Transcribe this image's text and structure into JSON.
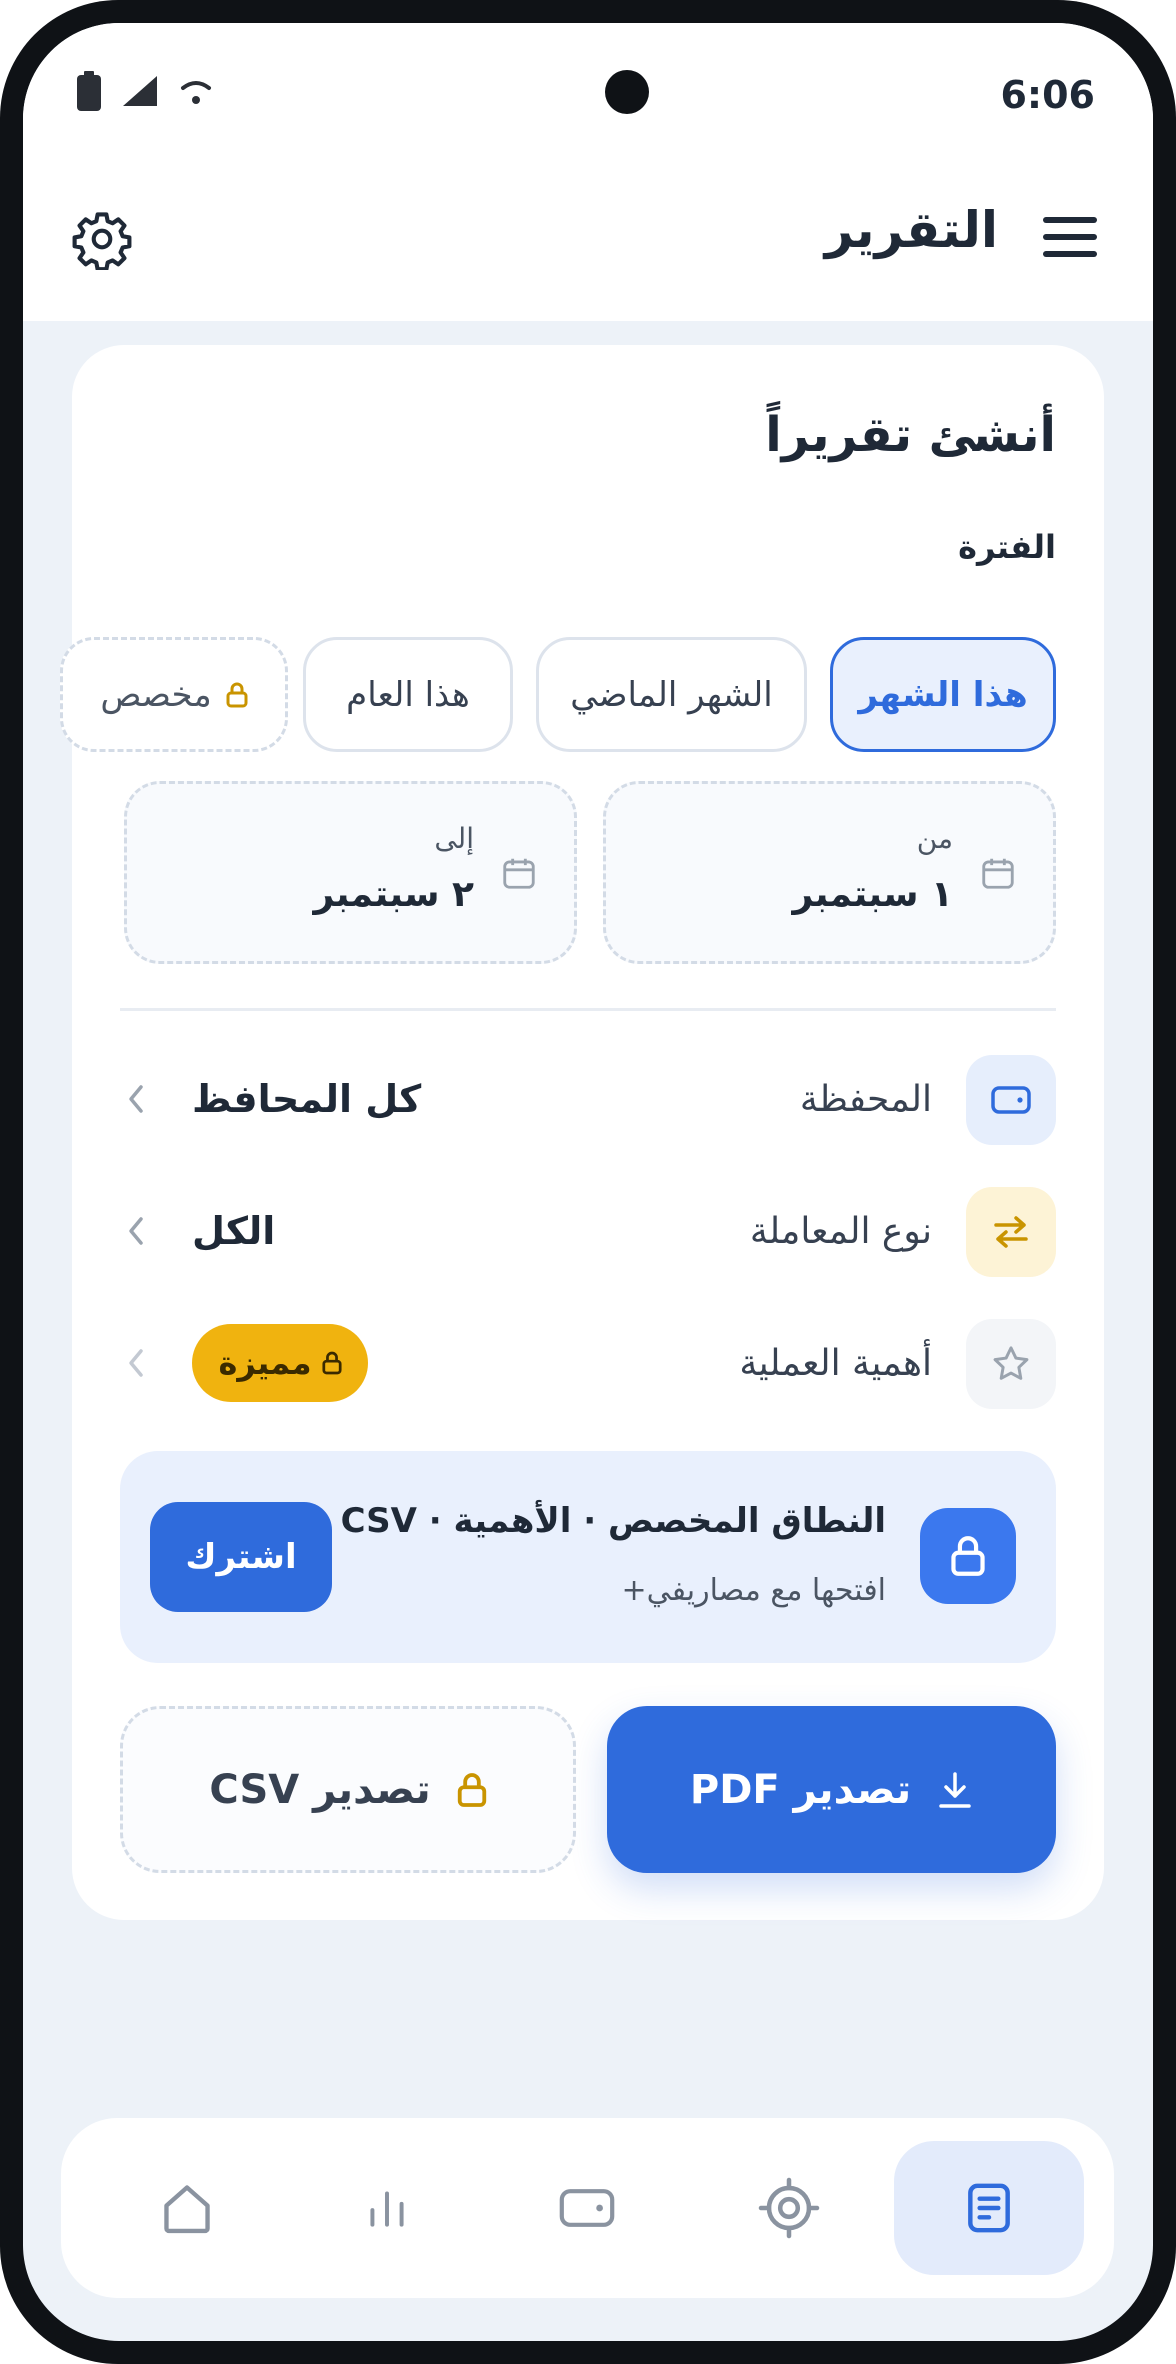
{
  "status_bar": {
    "time": "6:06"
  },
  "header": {
    "title": "التقرير"
  },
  "report": {
    "card_title": "أنشئ تقريراً",
    "period_label": "الفترة",
    "period_chips": [
      {
        "label": "هذا الشهر",
        "active": true
      },
      {
        "label": "الشهر الماضي",
        "active": false
      },
      {
        "label": "هذا العام",
        "active": false
      },
      {
        "label": "مخصص",
        "active": false,
        "locked": true
      }
    ],
    "date_from": {
      "caption": "من",
      "value": "١ سبتمبر"
    },
    "date_to": {
      "caption": "إلى",
      "value": "٢ سبتمبر"
    },
    "filters": [
      {
        "label": "المحفظة",
        "value": "كل المحافظ",
        "icon": "wallet-icon",
        "icon_bg": "#e6eefc",
        "icon_color": "#2f6bdc"
      },
      {
        "label": "نوع المعاملة",
        "value": "الكل",
        "icon": "swap-icon",
        "icon_bg": "#fdf3d6",
        "icon_color": "#c99400"
      },
      {
        "label": "أهمية العملية",
        "badge": "مميزة",
        "icon": "star-icon",
        "icon_bg": "#f3f5f8",
        "icon_color": "#9aa3ae"
      }
    ],
    "upsell": {
      "title": "النطاق المخصص · الأهمية · CSV",
      "subtitle": "افتحها مع مصاريفي+",
      "button": "اشترك"
    },
    "export_pdf": "تصدير PDF",
    "export_csv": "تصدير CSV"
  },
  "bottom_nav": {
    "items": [
      {
        "name": "reports",
        "icon": "report-icon",
        "active": true
      },
      {
        "name": "goals",
        "icon": "target-icon",
        "active": false
      },
      {
        "name": "wallets",
        "icon": "wallet-icon",
        "active": false
      },
      {
        "name": "stats",
        "icon": "bar-chart-icon",
        "active": false
      },
      {
        "name": "home",
        "icon": "home-icon",
        "active": false
      }
    ]
  },
  "colors": {
    "accent": "#2f6bdc",
    "premium": "#f0b30f",
    "background": "#edf2f8"
  }
}
